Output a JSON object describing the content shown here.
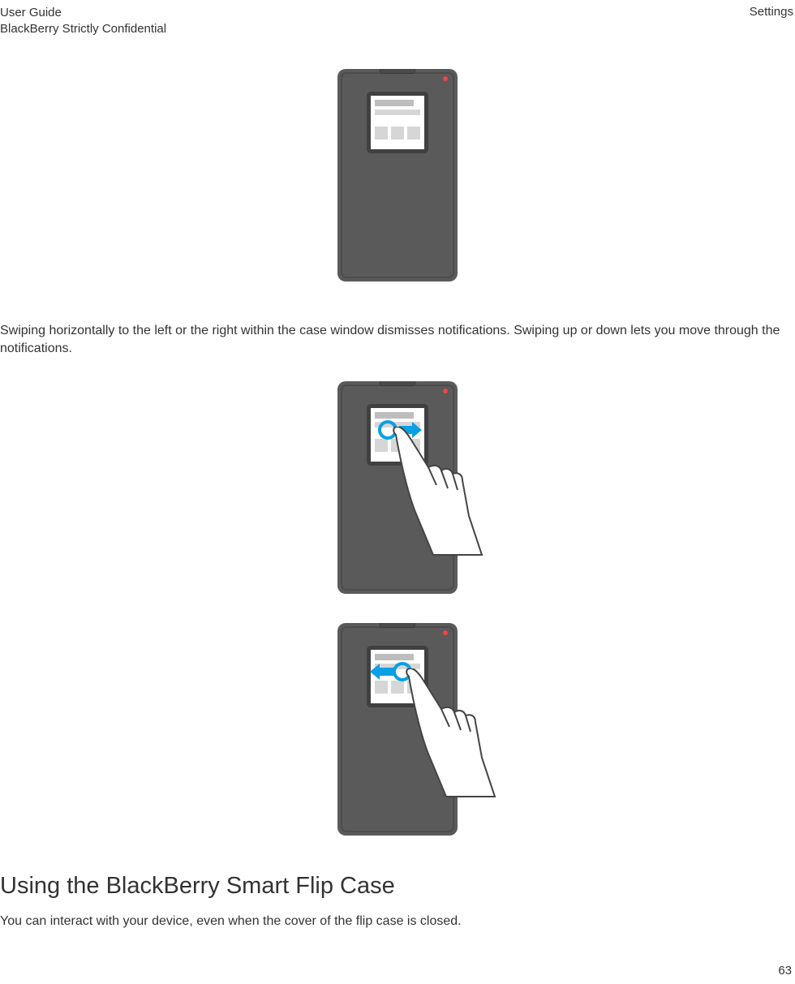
{
  "header": {
    "title": "User Guide",
    "subtitle": "BlackBerry Strictly Confidential",
    "section": "Settings"
  },
  "paragraphs": {
    "swipe_text": "Swiping horizontally to the left or the right within the case window dismisses notifications. Swiping up or down lets you move through the notifications.",
    "section_heading": "Using the BlackBerry Smart Flip Case",
    "section_body": "You can interact with your device, even when the cover of the flip case is closed."
  },
  "footer": {
    "page": "63"
  }
}
